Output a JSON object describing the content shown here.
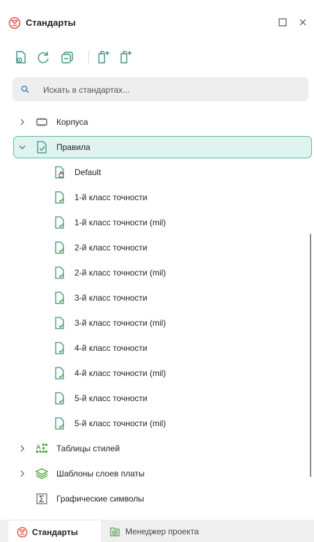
{
  "panel": {
    "title": "Стандарты",
    "maximize_icon": "maximize-icon",
    "close_icon": "close-icon"
  },
  "toolbar": {
    "buttons": [
      "view-document-icon",
      "refresh-icon",
      "collapse-all-icon",
      "add-item-icon",
      "add-folder-icon"
    ]
  },
  "search": {
    "placeholder": "Искать в стандартах..."
  },
  "tree": {
    "housings": "Корпуса",
    "rules": "Правила",
    "rule_items": [
      "Default",
      "1-й класс точности",
      "1-й класс точности (mil)",
      "2-й класс точности",
      "2-й класс точности (mil)",
      "3-й класс точности",
      "3-й класс точности (mil)",
      "4-й класс точности",
      "4-й класс точности (mil)",
      "5-й класс точности",
      "5-й класс точности (mil)"
    ],
    "style_tables": "Таблицы стилей",
    "layer_templates": "Шаблоны слоев платы",
    "graphic_symbols": "Графические символы"
  },
  "tabs": {
    "standards": "Стандарты",
    "project_manager": "Менеджер проекта"
  },
  "colors": {
    "accent_red": "#e0533f",
    "accent_teal": "#5cb7ab",
    "selected_bg": "#dff3ef"
  }
}
